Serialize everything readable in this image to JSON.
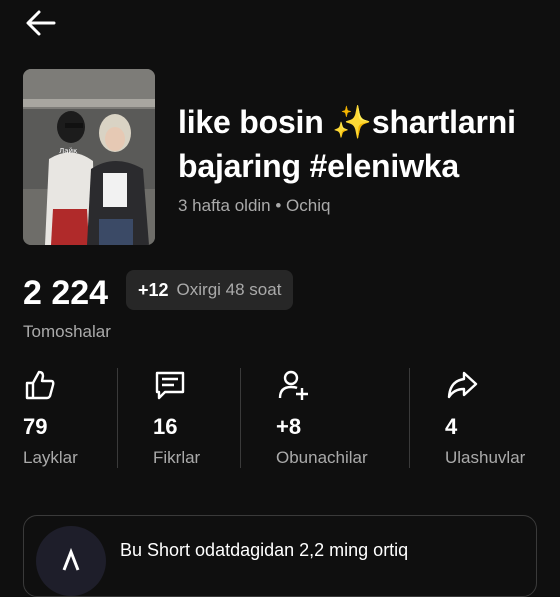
{
  "video": {
    "title_line1": "like bosin ✨shartlarni",
    "title_line2": "bajaring #eleniwka",
    "meta": "3 hafta oldin • Ochiq"
  },
  "views": {
    "count": "2 224",
    "recent_change": "+12",
    "recent_label": "Oxirgi 48 soat",
    "label": "Tomoshalar"
  },
  "stats": [
    {
      "value": "79",
      "label": "Layklar",
      "icon": "thumbs-up-icon"
    },
    {
      "value": "16",
      "label": "Fikrlar",
      "icon": "comment-icon"
    },
    {
      "value": "+8",
      "label": "Obunachilar",
      "icon": "add-person-icon"
    },
    {
      "value": "4",
      "label": "Ulashuvlar",
      "icon": "share-icon"
    }
  ],
  "insight": {
    "text": "Bu Short odatdagidan 2,2 ming ortiq"
  },
  "colors": {
    "background": "#0f0f0f",
    "secondary_text": "#aaaaaa",
    "badge_bg": "#272727",
    "divider": "#3a3a3a"
  }
}
